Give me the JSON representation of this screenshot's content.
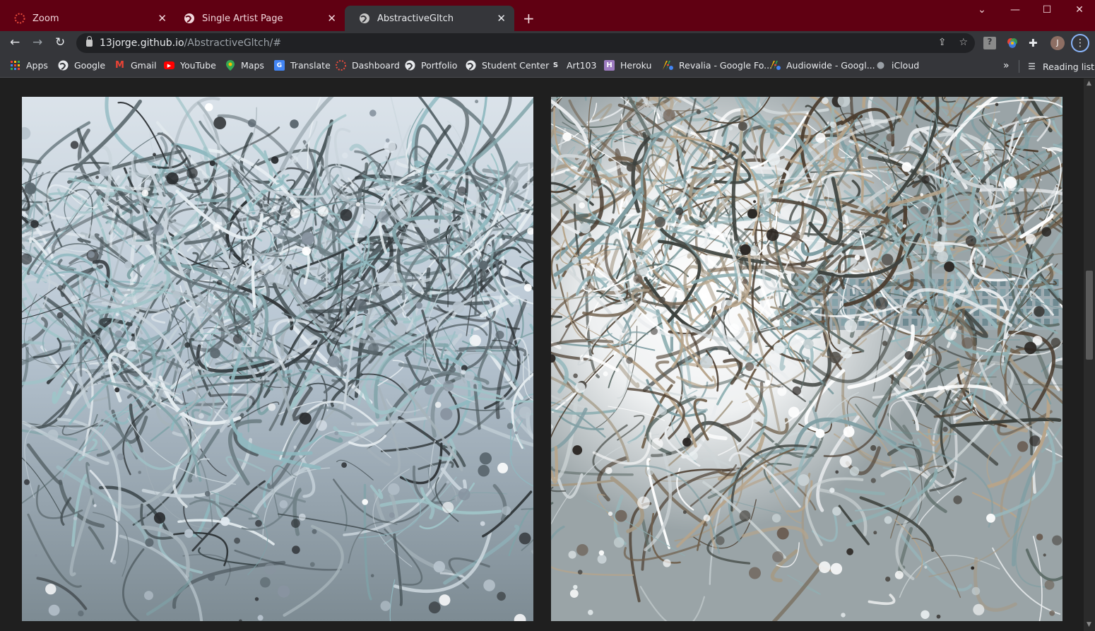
{
  "tabs": [
    {
      "title": "Zoom",
      "icon": "zoom-icon",
      "active": false
    },
    {
      "title": "Single Artist Page",
      "icon": "globe-icon",
      "active": false
    },
    {
      "title": "AbstractiveGltch",
      "icon": "globe-icon",
      "active": true
    }
  ],
  "address": {
    "host": "13jorge.github.io",
    "path": "/AbstractiveGltch/#"
  },
  "profile_initial": "J",
  "bookmarks": [
    {
      "label": "Apps",
      "icon": "apps-grid-icon"
    },
    {
      "label": "Google",
      "icon": "globe-icon"
    },
    {
      "label": "Gmail",
      "icon": "gmail-icon"
    },
    {
      "label": "YouTube",
      "icon": "youtube-icon"
    },
    {
      "label": "Maps",
      "icon": "maps-pin-icon"
    },
    {
      "label": "Translate",
      "icon": "translate-icon"
    },
    {
      "label": "Dashboard",
      "icon": "dashboard-icon"
    },
    {
      "label": "Portfolio",
      "icon": "globe-icon"
    },
    {
      "label": "Student Center",
      "icon": "globe-icon"
    },
    {
      "label": "Art103",
      "icon": "s-badge-icon",
      "badge": "S"
    },
    {
      "label": "Heroku",
      "icon": "heroku-icon",
      "badge": "H"
    },
    {
      "label": "Revalia - Google Fo...",
      "icon": "google-fonts-icon"
    },
    {
      "label": "Audiowide - Googl...",
      "icon": "google-fonts-icon"
    },
    {
      "label": "iCloud",
      "icon": "apple-icon"
    }
  ],
  "reading_list": "Reading list",
  "colors": {
    "tab_strip": "#600012",
    "toolbar": "#35363a",
    "page_bg": "#1f1f1f",
    "accent": "#8ab4f8"
  }
}
